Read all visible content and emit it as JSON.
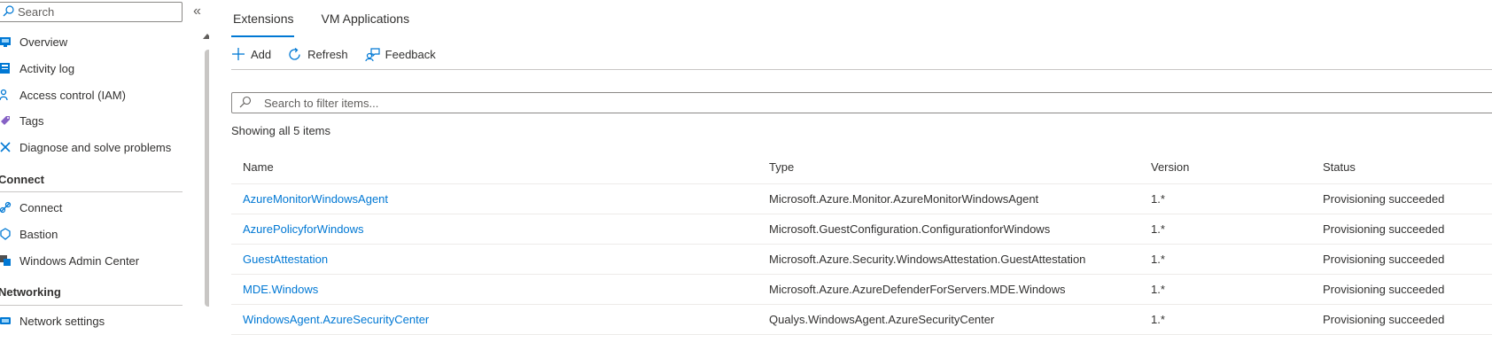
{
  "sidebar": {
    "search_placeholder": "Search",
    "collapse_glyph": "«",
    "items_top": [
      {
        "label": "Overview",
        "icon": "overview-icon"
      },
      {
        "label": "Activity log",
        "icon": "activity-log-icon"
      },
      {
        "label": "Access control (IAM)",
        "icon": "iam-icon"
      },
      {
        "label": "Tags",
        "icon": "tag-icon"
      },
      {
        "label": "Diagnose and solve problems",
        "icon": "diagnose-icon"
      }
    ],
    "group_connect": {
      "header": "Connect",
      "items": [
        {
          "label": "Connect",
          "icon": "connect-icon"
        },
        {
          "label": "Bastion",
          "icon": "bastion-icon"
        },
        {
          "label": "Windows Admin Center",
          "icon": "windows-admin-center-icon"
        }
      ]
    },
    "group_networking": {
      "header": "Networking",
      "items": [
        {
          "label": "Network settings",
          "icon": "network-settings-icon"
        }
      ]
    }
  },
  "tabs": [
    {
      "label": "Extensions",
      "active": true
    },
    {
      "label": "VM Applications",
      "active": false
    }
  ],
  "toolbar": {
    "add_label": "Add",
    "refresh_label": "Refresh",
    "feedback_label": "Feedback"
  },
  "filter": {
    "placeholder": "Search to filter items..."
  },
  "showing_text": "Showing all 5 items",
  "table": {
    "columns": [
      "Name",
      "Type",
      "Version",
      "Status"
    ],
    "rows": [
      {
        "name": "AzureMonitorWindowsAgent",
        "type": "Microsoft.Azure.Monitor.AzureMonitorWindowsAgent",
        "version": "1.*",
        "status": "Provisioning succeeded"
      },
      {
        "name": "AzurePolicyforWindows",
        "type": "Microsoft.GuestConfiguration.ConfigurationforWindows",
        "version": "1.*",
        "status": "Provisioning succeeded"
      },
      {
        "name": "GuestAttestation",
        "type": "Microsoft.Azure.Security.WindowsAttestation.GuestAttestation",
        "version": "1.*",
        "status": "Provisioning succeeded"
      },
      {
        "name": "MDE.Windows",
        "type": "Microsoft.Azure.AzureDefenderForServers.MDE.Windows",
        "version": "1.*",
        "status": "Provisioning succeeded"
      },
      {
        "name": "WindowsAgent.AzureSecurityCenter",
        "type": "Qualys.WindowsAgent.AzureSecurityCenter",
        "version": "1.*",
        "status": "Provisioning succeeded"
      }
    ]
  },
  "colors": {
    "accent": "#0078d4",
    "text": "#323130",
    "border": "#c8c6c4"
  }
}
